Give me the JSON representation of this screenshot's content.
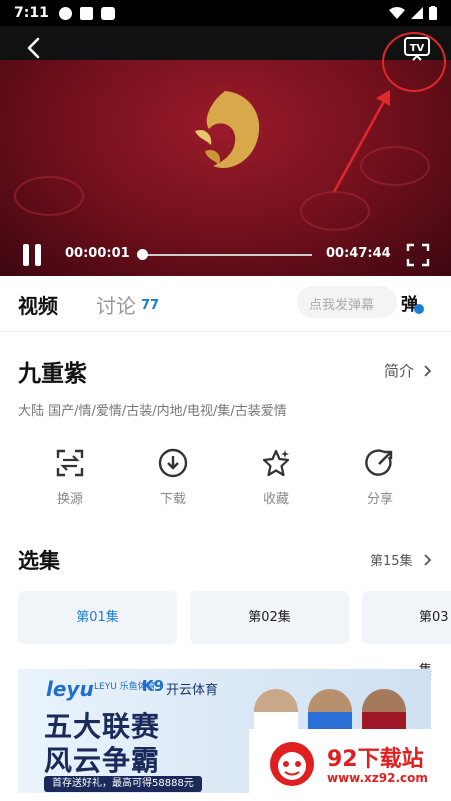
{
  "status_bar": {
    "time": "7:11"
  },
  "player": {
    "current_time": "00:00:01",
    "total_time": "00:47:44",
    "progress": 0.0
  },
  "tabs": {
    "video_label": "视频",
    "discuss_label": "讨论",
    "discuss_count": "77",
    "danmu_placeholder": "点我发弹幕",
    "danmu_toggle_label": "弹"
  },
  "show": {
    "title": "九重紫",
    "intro_label": "简介",
    "tags": "大陆  国产/情/爱情/古装/内地/电视/集/古装爱情"
  },
  "actions": [
    {
      "label": "换源",
      "icon": "switch-source-icon"
    },
    {
      "label": "下载",
      "icon": "download-icon"
    },
    {
      "label": "收藏",
      "icon": "star-icon"
    },
    {
      "label": "分享",
      "icon": "share-icon"
    }
  ],
  "episodes": {
    "title": "选集",
    "count_label": "第15集",
    "items": [
      "第01集",
      "第02集",
      "第03集"
    ]
  },
  "ad": {
    "brand": "leyu",
    "brand_sub": "LEYU 乐鱼体育",
    "brand2": "K9",
    "brand2_text": "开云体育",
    "line1": "五大联赛",
    "line2": "风云争霸",
    "promo": "首存送好礼，最高可得58888元"
  },
  "watermark": {
    "name": "92下载站",
    "url": "www.xz92.com"
  },
  "colors": {
    "accent_blue": "#1a7fd4",
    "annotation_red": "#e0282a",
    "watermark_red": "#e02020"
  }
}
